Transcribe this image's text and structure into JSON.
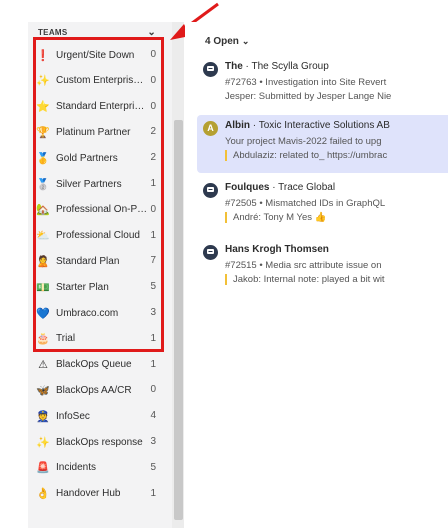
{
  "sidebar": {
    "header": "TEAMS",
    "items": [
      {
        "icon": "exclamation-icon",
        "glyph": "❗",
        "label": "Urgent/Site Down",
        "count": "0"
      },
      {
        "icon": "sparkle-icon",
        "glyph": "✨",
        "label": "Custom Enterprise S...",
        "count": "0"
      },
      {
        "icon": "star-icon",
        "glyph": "⭐",
        "label": "Standard Enterprise ...",
        "count": "0"
      },
      {
        "icon": "trophy-icon",
        "glyph": "🏆",
        "label": "Platinum Partner",
        "count": "2"
      },
      {
        "icon": "gold-medal-icon",
        "glyph": "🥇",
        "label": "Gold Partners",
        "count": "2"
      },
      {
        "icon": "silver-medal-icon",
        "glyph": "🥈",
        "label": "Silver Partners",
        "count": "1"
      },
      {
        "icon": "house-icon",
        "glyph": "🏡",
        "label": "Professional On-Prem",
        "count": "0"
      },
      {
        "icon": "sun-cloud-icon",
        "glyph": "⛅",
        "label": "Professional Cloud",
        "count": "1"
      },
      {
        "icon": "person-icon",
        "glyph": "🙎",
        "label": "Standard Plan",
        "count": "7"
      },
      {
        "icon": "money-icon",
        "glyph": "💵",
        "label": "Starter Plan",
        "count": "5"
      },
      {
        "icon": "blue-heart-icon",
        "glyph": "💙",
        "label": "Umbraco.com",
        "count": "3"
      },
      {
        "icon": "cake-icon",
        "glyph": "🎂",
        "label": "Trial",
        "count": "1"
      },
      {
        "icon": "warning-icon",
        "glyph": "⚠",
        "label": "BlackOps Queue",
        "count": "1"
      },
      {
        "icon": "butterfly-icon",
        "glyph": "🦋",
        "label": "BlackOps AA/CR",
        "count": "0"
      },
      {
        "icon": "officer-icon",
        "glyph": "👮",
        "label": "InfoSec",
        "count": "4"
      },
      {
        "icon": "sparkle-icon",
        "glyph": "✨",
        "label": "BlackOps response",
        "count": "3"
      },
      {
        "icon": "incident-icon",
        "glyph": "🚨",
        "label": "Incidents",
        "count": "5"
      },
      {
        "icon": "handshake-icon",
        "glyph": "👌",
        "label": "Handover Hub",
        "count": "1"
      }
    ]
  },
  "inbox": {
    "filter": "4 Open",
    "conversations": [
      {
        "avatar": "",
        "avatar_color": "#2e3a4f",
        "name": "The",
        "company": "The Scylla Group",
        "line2": "#72763 • Investigation into Site Revert",
        "line3": "Jesper: Submitted by Jesper Lange Nie"
      },
      {
        "avatar": "A",
        "avatar_color": "#b5a032",
        "name": "Albin",
        "company": "Toxic Interactive Solutions AB",
        "line2": "Your project Mavis-2022 failed to upg",
        "line3": "Abdulaziz: related to_ https://umbrac"
      },
      {
        "avatar": "",
        "avatar_color": "#2e3a4f",
        "name": "Foulques",
        "company": "Trace Global",
        "line2": "#72505 • Mismatched IDs in GraphQL",
        "line3": "André: Tony M Yes 👍"
      },
      {
        "avatar": "",
        "avatar_color": "#2e3a4f",
        "name": "Hans Krogh Thomsen",
        "company": "",
        "line2": "#72515 • Media src attribute issue on",
        "line3": "Jakob: Internal note: played a bit wit"
      }
    ]
  },
  "colors": {
    "highlight_box": "#e01a1a",
    "selected_row": "#dfe3fb",
    "sidebar_bg": "#f3f3f4"
  }
}
